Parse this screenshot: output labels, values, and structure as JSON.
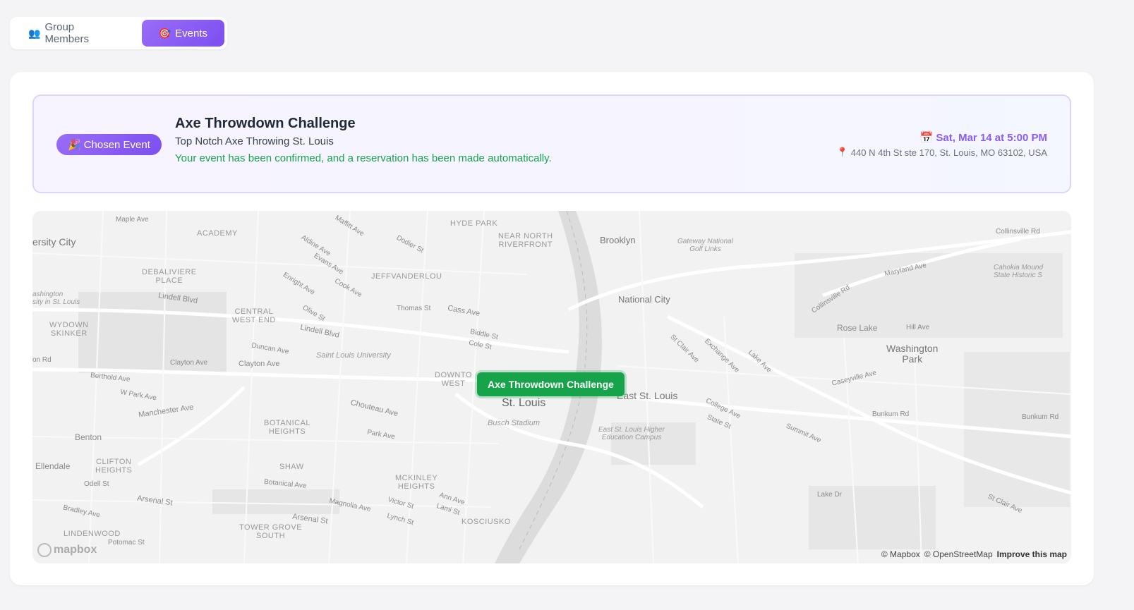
{
  "tabs": [
    {
      "icon": "👥",
      "label": "Group Members"
    },
    {
      "icon": "🎯",
      "label": "Events"
    }
  ],
  "event": {
    "badge_icon": "🎉",
    "badge_label": "Chosen Event",
    "title": "Axe Throwdown Challenge",
    "venue": "Top Notch Axe Throwing St. Louis",
    "confirmation": "Your event has been confirmed, and a reservation has been made automatically.",
    "date_icon": "📅",
    "date": "Sat, Mar 14 at 5:00 PM",
    "address_icon": "📍",
    "address": "440 N 4th St ste 170, St. Louis, MO 63102, USA"
  },
  "map": {
    "marker_label": "Axe Throwdown Challenge",
    "logo": "mapbox",
    "attribution": [
      "© Mapbox",
      "© OpenStreetMap",
      "Improve this map"
    ],
    "labels": {
      "st_louis": "St. Louis",
      "east_st_louis": "East St. Louis",
      "brooklyn": "Brooklyn",
      "national_city": "National City",
      "washington_park": "Washington\nPark",
      "university_city": "ersity City",
      "benton": "Benton",
      "ellendale": "Ellendale",
      "busch_stadium": "Busch Stadium",
      "slu": "Saint Louis University",
      "hyde_park": "HYDE PARK",
      "near_north": "NEAR NORTH\nRIVERFRONT",
      "jeff_vander_lou": "JEFFVANDERLOU",
      "academy": "ACADEMY",
      "debaliviere": "DEBALIVIERE\nPLACE",
      "central_west_end": "CENTRAL\nWEST END",
      "wydown": "WYDOWN\nSKINKER",
      "botanical": "BOTANICAL\nHEIGHTS",
      "shaw": "SHAW",
      "clifton": "CLIFTON\nHEIGHTS",
      "mckinley": "MCKINLEY\nHEIGHTS",
      "tower_grove": "TOWER GROVE\nSOUTH",
      "kosciusko": "KOSCIUSKO",
      "downtown": "DOWNTO\nWEST",
      "lindenwood": "LINDENWOOD",
      "rose_lake": "Rose Lake",
      "gateway": "Gateway National\nGolf Links",
      "cahokia": "Cahokia Mound\nState Historic S",
      "esl_campus": "East St. Louis Higher\nEducation Campus",
      "wash_u": "ashington\nsity in St. Louis",
      "lindell1": "Lindell Blvd",
      "lindell2": "Lindell Blvd",
      "clayton": "Clayton Ave",
      "clayton2": "Clayton Ave",
      "duncan": "Duncan Ave",
      "berthold": "Berthold Ave",
      "wpark": "W Park Ave",
      "manchester": "Manchester Ave",
      "chouteau": "Chouteau Ave",
      "park": "Park Ave",
      "botanical_ave": "Botanical Ave",
      "arsenal": "Arsenal St",
      "arsenal2": "Arsenal St",
      "magnolia": "Magnolia Ave",
      "victor": "Victor St",
      "lynch": "Lynch St",
      "ann": "Ann Ave",
      "lami": "Lami St",
      "odell": "Odell St",
      "bradley": "Bradley Ave",
      "potomac": "Potomac St",
      "thomas": "Thomas St",
      "cass": "Cass Ave",
      "biddle": "Biddle St",
      "cole": "Cole St",
      "dodier": "Dodier St",
      "cook": "Cook Ave",
      "olive": "Olive St",
      "enright": "Enright Ave",
      "aldine": "Aldine Ave",
      "evans": "Evans Ave",
      "maffitt": "Maffitt Ave",
      "maple": "Maple Ave",
      "collinsville_rd": "Collinsville Rd",
      "collinsville_rd2": "Collinsville Rd",
      "maryland": "Maryland Ave",
      "hill": "Hill Ave",
      "bunkum": "Bunkum Rd",
      "bunkum2": "Bunkum Rd",
      "summit": "Summit Ave",
      "state": "State St",
      "college": "College Ave",
      "stclair": "St Clair Ave",
      "stclair2": "St Clair Ave",
      "exchange": "Exchange Ave",
      "lake_ave": "Lake Ave",
      "caseyville": "Caseyville Ave",
      "lake_dr": "Lake Dr",
      "on_rd": "on Rd"
    }
  }
}
